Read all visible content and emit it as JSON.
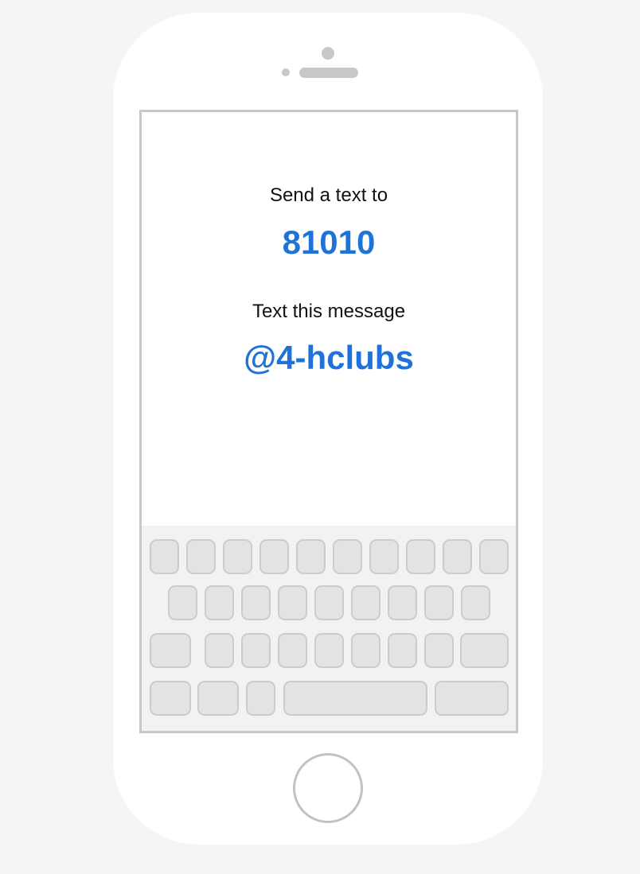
{
  "screen": {
    "send_label": "Send a text to",
    "number": "81010",
    "message_label": "Text this message",
    "message_code": "@4-hclubs"
  },
  "keyboard": {
    "rows": [
      [
        "",
        "",
        "",
        "",
        "",
        "",
        "",
        "",
        "",
        ""
      ],
      [
        "",
        "",
        "",
        "",
        "",
        "",
        "",
        "",
        ""
      ],
      [
        "",
        "",
        "",
        "",
        "",
        "",
        "",
        "",
        ""
      ],
      [
        "",
        "",
        "",
        "",
        ""
      ]
    ]
  },
  "colors": {
    "accent": "#1f73d8",
    "background": "#f5f5f5",
    "device": "#ffffff",
    "outline": "#c8c8c8",
    "key_fill": "#e3e3e3"
  },
  "icons": {
    "camera": "camera-icon",
    "home": "home-button-icon"
  }
}
